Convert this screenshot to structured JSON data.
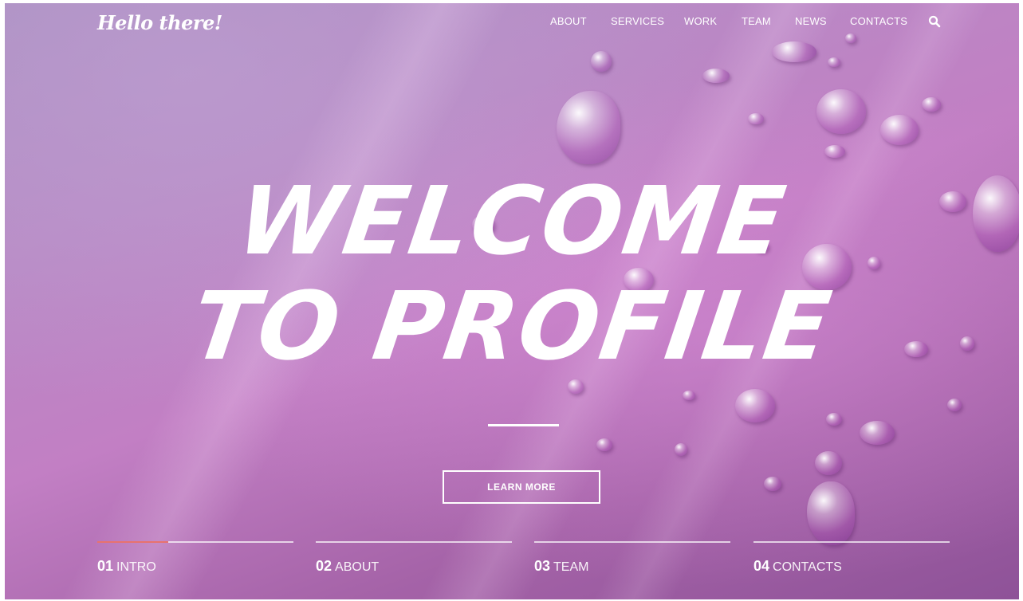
{
  "brand": {
    "logo_text": "Hello there!"
  },
  "nav": {
    "items": [
      {
        "label": "ABOUT"
      },
      {
        "label": "SERVICES"
      },
      {
        "label": "WORK"
      },
      {
        "label": "TEAM"
      },
      {
        "label": "NEWS"
      },
      {
        "label": "CONTACTS"
      }
    ],
    "search_icon": "search-icon"
  },
  "hero": {
    "line1": "WELCOME",
    "line2": "TO PROFILE",
    "cta_label": "LEARN MORE"
  },
  "slides": [
    {
      "num": "01",
      "name": "INTRO",
      "active": true,
      "progress": 0.36
    },
    {
      "num": "02",
      "name": "ABOUT",
      "active": false,
      "progress": 0
    },
    {
      "num": "03",
      "name": "TEAM",
      "active": false,
      "progress": 0
    },
    {
      "num": "04",
      "name": "CONTACTS",
      "active": false,
      "progress": 0
    }
  ],
  "colors": {
    "accent": "#e8726e",
    "text": "#ffffff",
    "background_top": "#a98ec0",
    "background_bottom": "#8e5298"
  }
}
